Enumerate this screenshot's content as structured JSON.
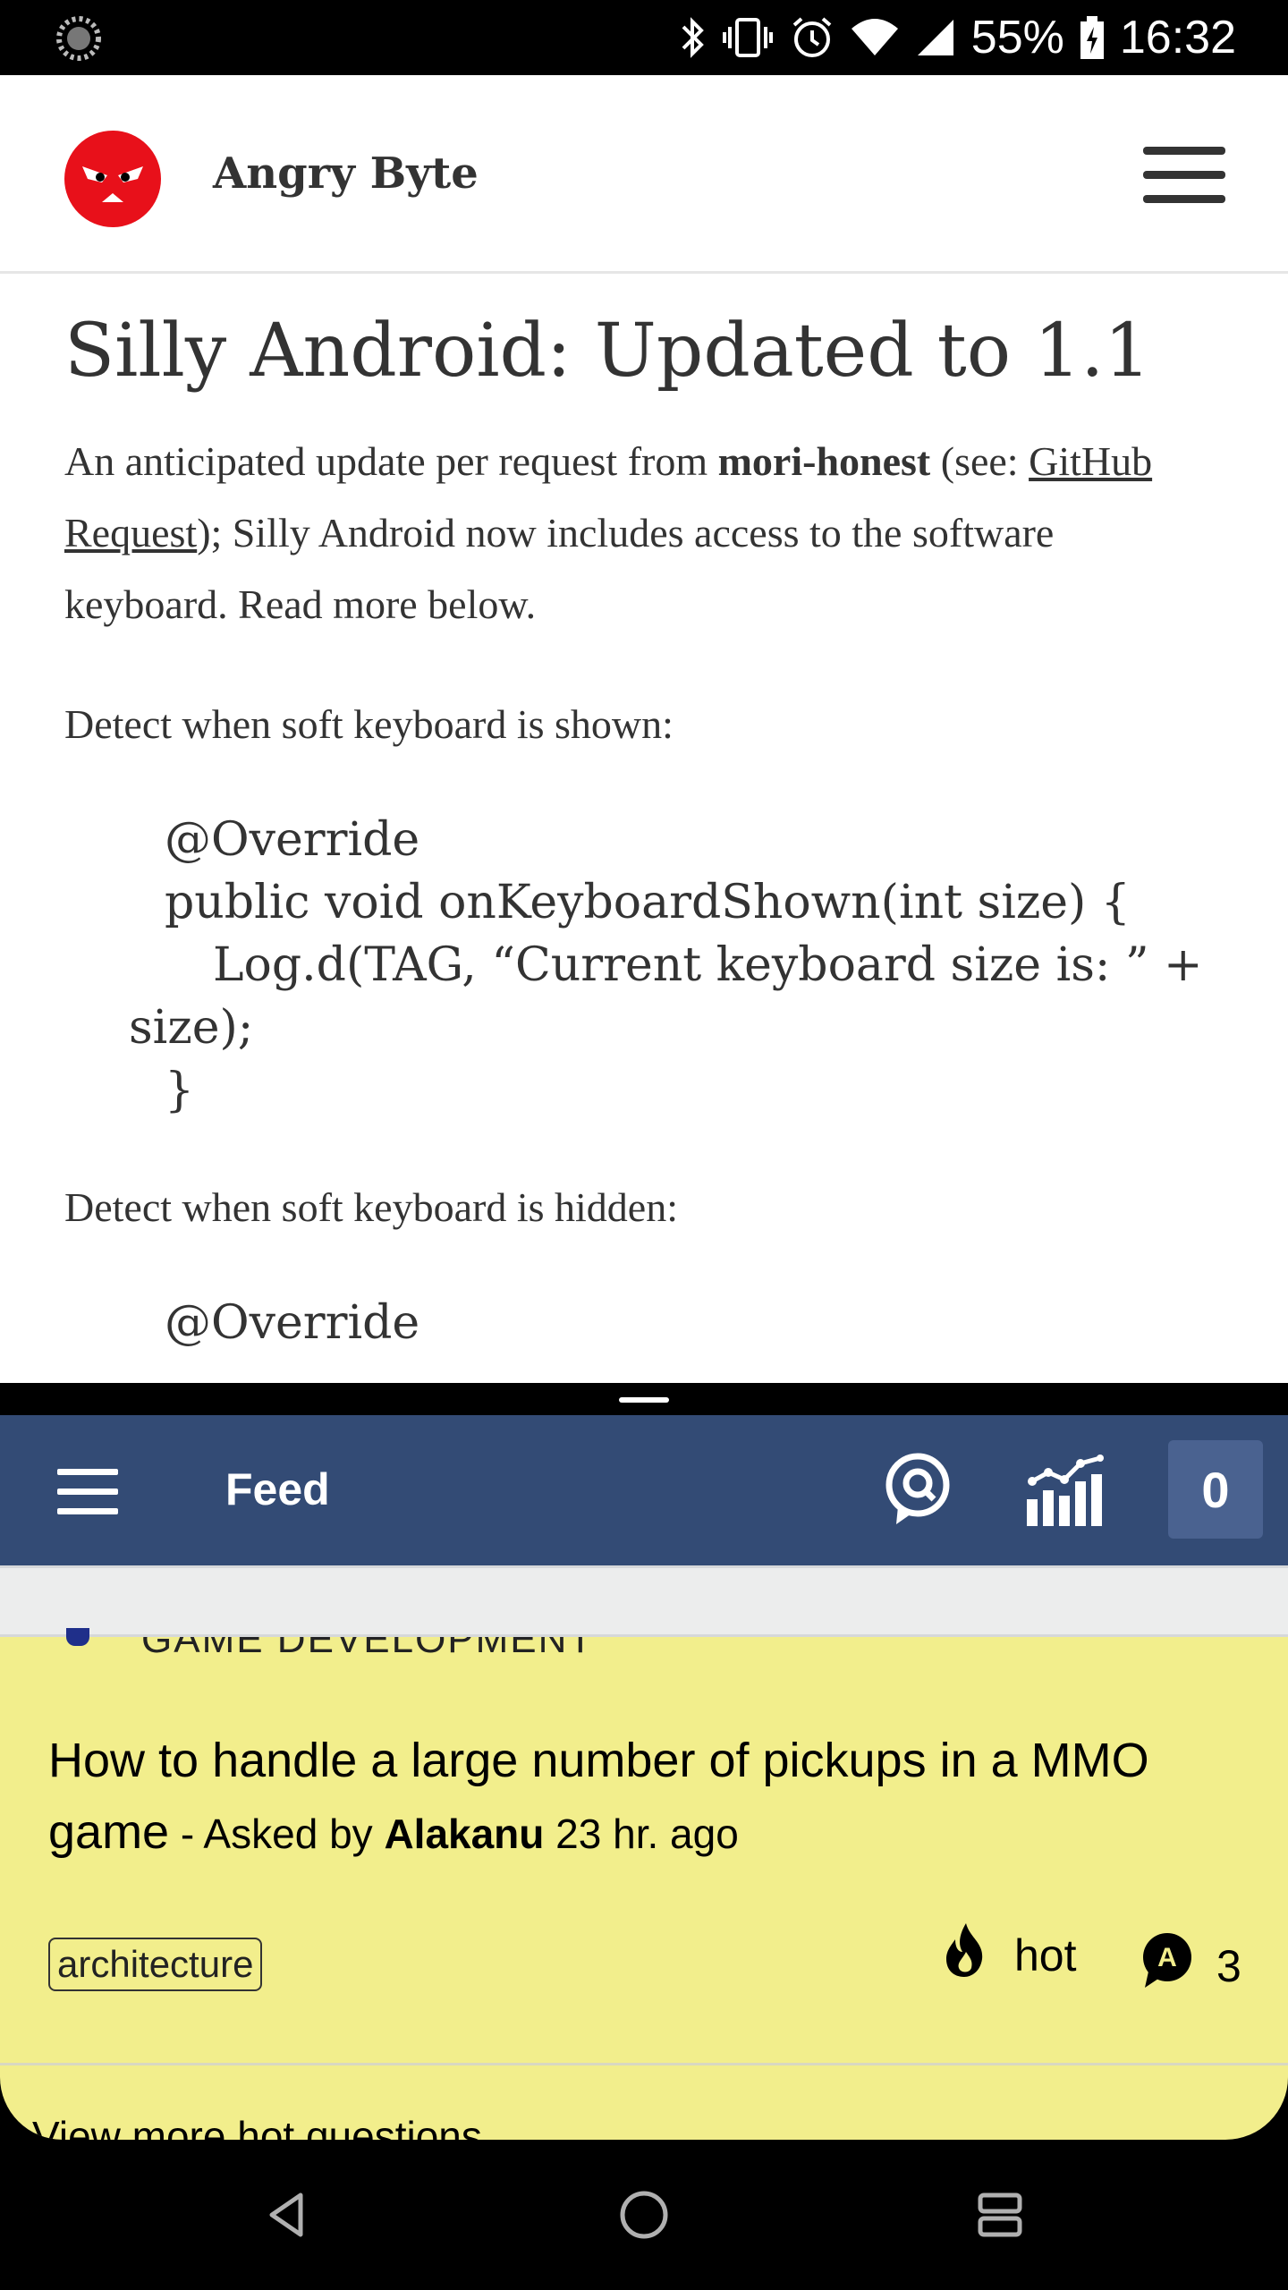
{
  "status_bar": {
    "battery": "55%",
    "time": "16:32",
    "icons": [
      "loading-icon",
      "bluetooth-icon",
      "vibrate-icon",
      "alarm-icon",
      "wifi-icon",
      "signal-icon",
      "battery-charging-icon"
    ]
  },
  "browser": {
    "site_title": "Angry Byte",
    "post_title": "Silly Android: Updated to 1.1",
    "intro_part1": "An anticipated update per request from ",
    "intro_bold": "mori-honest",
    "intro_part2": " (see: ",
    "intro_link": "GitHub Request",
    "intro_part3": "); Silly Android now includes access to the software keyboard. Read more below.",
    "shown_heading": "Detect when soft keyboard is shown:",
    "code_shown": [
      "@Override",
      "public void onKeyboardShown(int size) {",
      "Log.d(TAG, “Current keyboard size is: ” +",
      "size);",
      "}"
    ],
    "hidden_heading": "Detect when soft keyboard is hidden:",
    "code_hidden_first": "@Override"
  },
  "feed_app": {
    "title": "Feed",
    "count": "0",
    "section_label": "GAME DEVELOPMENT",
    "question": {
      "title": "How to handle a large number of pickups in a MMO game",
      "asked_prefix": " - Asked by ",
      "author": "Alakanu",
      "time": " 23 hr. ago",
      "tag": "architecture",
      "hot_label": "hot",
      "answers": "3"
    },
    "view_more": "View more hot questions",
    "colors": {
      "header": "#334b75",
      "card": "#f2ee8c",
      "count_box": "#4a6290"
    }
  },
  "nav": {
    "buttons": [
      "back-icon",
      "home-icon",
      "recents-icon"
    ]
  },
  "brand": {
    "logo_color": "#e8101a"
  }
}
